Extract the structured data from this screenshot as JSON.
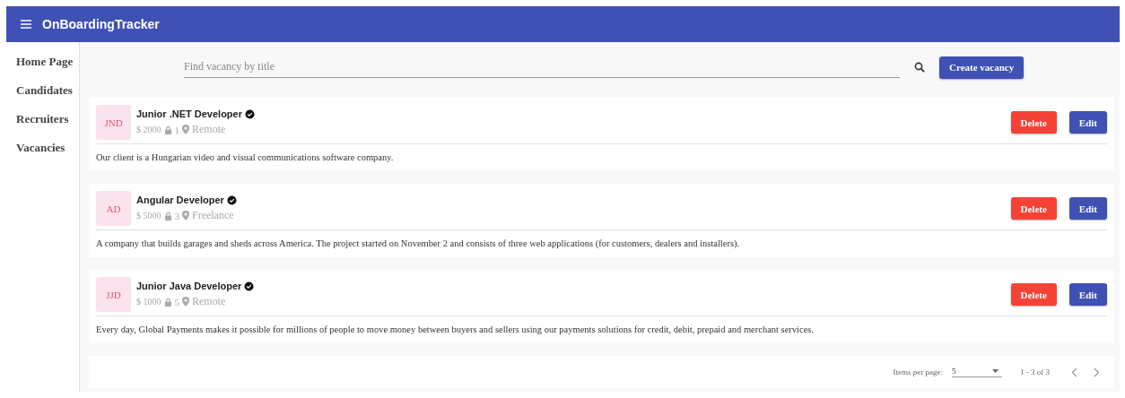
{
  "app_bar": {
    "title": "OnBoardingTracker"
  },
  "sidebar": {
    "items": [
      {
        "label": "Home Page"
      },
      {
        "label": "Candidates"
      },
      {
        "label": "Recruiters"
      },
      {
        "label": "Vacancies"
      }
    ]
  },
  "search": {
    "placeholder": "Find vacancy by title"
  },
  "create_button": "Create vacancy",
  "vacancies": [
    {
      "initials": "JND",
      "title": "Junior .NET Developer",
      "salary": "$ 2000",
      "openings": "1",
      "location": "Remote",
      "description": "Our client is a Hungarian video and visual communications software company.",
      "delete": "Delete",
      "edit": "Edit"
    },
    {
      "initials": "AD",
      "title": "Angular Developer",
      "salary": "$ 5000",
      "openings": "3",
      "location": "Freelance",
      "description": "A company that builds garages and sheds across America. The project started on November 2 and consists of three web applications (for customers, dealers and installers).",
      "delete": "Delete",
      "edit": "Edit"
    },
    {
      "initials": "JJD",
      "title": "Junior Java Developer",
      "salary": "$ 1000",
      "openings": "5",
      "location": "Remote",
      "description": "Every day, Global Payments makes it possible for millions of people to move money between buyers and sellers using our payments solutions for credit, debit, prepaid and merchant services.",
      "delete": "Delete",
      "edit": "Edit"
    }
  ],
  "paginator": {
    "label": "Items per page:",
    "page_size": "5",
    "range": "1 - 3 of 3"
  }
}
